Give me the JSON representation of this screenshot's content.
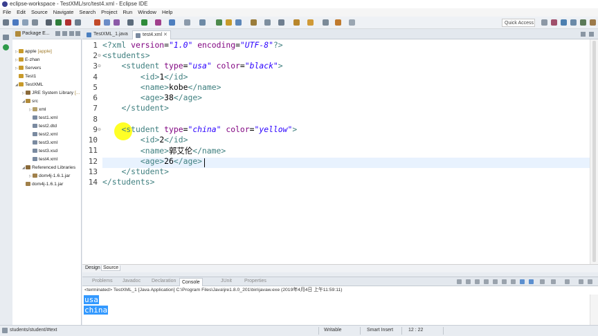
{
  "window": {
    "title": "eclipse-workspace - TestXML/src/test4.xml - Eclipse IDE"
  },
  "menu": [
    "File",
    "Edit",
    "Source",
    "Navigate",
    "Search",
    "Project",
    "Run",
    "Window",
    "Help"
  ],
  "toolbar": {
    "quick_access_placeholder": "Quick Access"
  },
  "package_explorer": {
    "title": "Package E...",
    "items": [
      {
        "label": "apple",
        "decoration": "[apple]"
      },
      {
        "label": "E-zhan",
        "decoration": ""
      },
      {
        "label": "Servers",
        "decoration": ""
      },
      {
        "label": "Test1",
        "decoration": ""
      },
      {
        "label": "TestXML",
        "decoration": ""
      },
      {
        "label": "JRE System Library",
        "decoration": "[..."
      },
      {
        "label": "src",
        "decoration": ""
      },
      {
        "label": "xml",
        "decoration": ""
      },
      {
        "label": "test1.xml",
        "decoration": ""
      },
      {
        "label": "test2.dtd",
        "decoration": ""
      },
      {
        "label": "test2.xml",
        "decoration": ""
      },
      {
        "label": "test3.xml",
        "decoration": ""
      },
      {
        "label": "test3.xsd",
        "decoration": ""
      },
      {
        "label": "test4.xml",
        "decoration": ""
      },
      {
        "label": "Referenced Libraries",
        "decoration": ""
      },
      {
        "label": "dom4j-1.6.1.jar",
        "decoration": ""
      },
      {
        "label": "dom4j-1.6.1.jar",
        "decoration": ""
      }
    ]
  },
  "editor_tabs": [
    {
      "label": "TestXML_1.java",
      "active": false
    },
    {
      "label": "test4.xml",
      "active": true
    }
  ],
  "code": {
    "line_numbers": [
      "1",
      "2",
      "3",
      "4",
      "5",
      "6",
      "7",
      "8",
      "9",
      "10",
      "11",
      "12",
      "13",
      "14"
    ],
    "l1": {
      "a": "<?xml ",
      "b": "version",
      "c": "=",
      "d": "\"1.0\"",
      "e": " ",
      "f": "encoding",
      "g": "=",
      "h": "\"UTF-8\"",
      "i": "?>"
    },
    "l2": "<students>",
    "l3": {
      "open": "<student ",
      "a1": "type",
      "eq1": "=",
      "v1": "\"usa\"",
      "sp": " ",
      "a2": "color",
      "eq2": "=",
      "v2": "\"black\"",
      "close": ">"
    },
    "l4": {
      "o": "<id>",
      "t": "1",
      "c": "</id>"
    },
    "l5": {
      "o": "<name>",
      "t": "kobe",
      "c": "</name>"
    },
    "l6": {
      "o": "<age>",
      "t": "38",
      "c": "</age>"
    },
    "l7": "</student>",
    "l9": {
      "open": "<student ",
      "a1": "type",
      "eq1": "=",
      "v1": "\"china\"",
      "sp": " ",
      "a2": "color",
      "eq2": "=",
      "v2": "\"yellow\"",
      "close": ">"
    },
    "l10": {
      "o": "<id>",
      "t": "2",
      "c": "</id>"
    },
    "l11": {
      "o": "<name>",
      "t": "郭艾伦",
      "c": "</name>"
    },
    "l12": {
      "o": "<age>",
      "t": "26",
      "c": "</age>"
    },
    "l13": "</student>",
    "l14": "</students>"
  },
  "bottom_tabs": {
    "design": "Design",
    "source": "Source"
  },
  "panel_tabs": [
    "Problems",
    "Javadoc",
    "Declaration",
    "Console",
    "JUnit",
    "Properties"
  ],
  "console": {
    "terminated": "<terminated> TestXML_1 [Java Application] C:\\Program Files\\Java\\jre1.8.0_201\\bin\\javaw.exe (2019年4月4日 上午11:59:11)",
    "output": [
      "usa",
      "china"
    ]
  },
  "status": {
    "path": "students/student/#text",
    "mode": "Writable",
    "insert": "Smart Insert",
    "position": "12 : 22"
  }
}
